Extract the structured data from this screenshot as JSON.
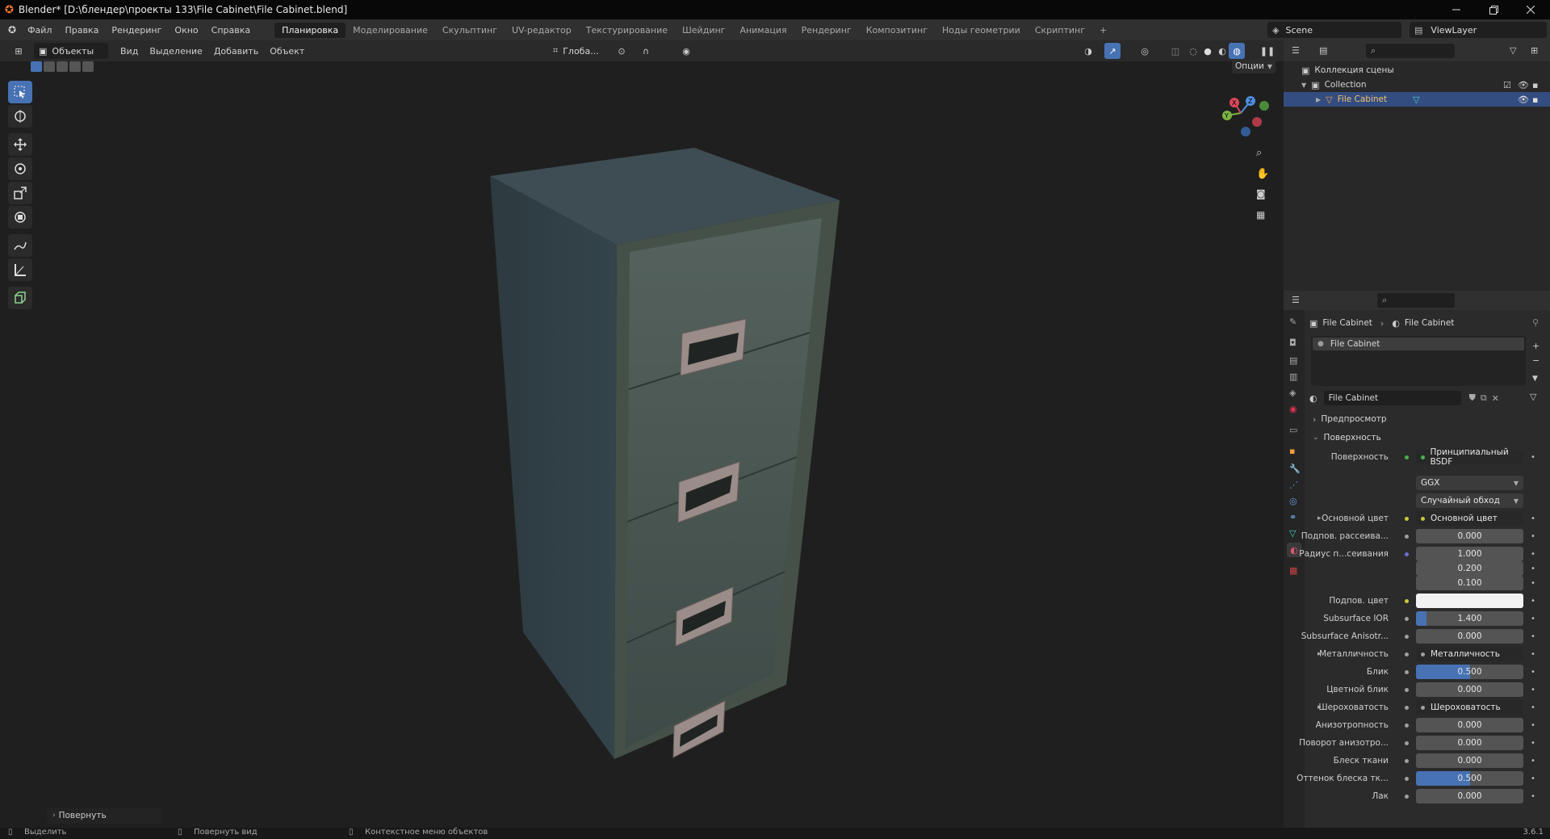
{
  "window": {
    "title": "Blender* [D:\\блендер\\проекты 133\\File Cabinet\\File Cabinet.blend]"
  },
  "menu": {
    "items": [
      "Файл",
      "Правка",
      "Рендеринг",
      "Окно",
      "Справка"
    ]
  },
  "workspaces": [
    "Планировка",
    "Моделирование",
    "Скульптинг",
    "UV-редактор",
    "Текстурирование",
    "Шейдинг",
    "Анимация",
    "Рендеринг",
    "Композитинг",
    "Ноды геометрии",
    "Скриптинг"
  ],
  "workspace_add": "+",
  "scene": {
    "name": "Scene",
    "view_layer": "ViewLayer"
  },
  "viewport_header": {
    "mode": "Объекты",
    "menus": [
      "Вид",
      "Выделение",
      "Добавить",
      "Объект"
    ],
    "orientation": "Глоба...",
    "options": "Опции"
  },
  "last_operator": "Повернуть",
  "outliner": {
    "root": "Коллекция сцены",
    "collection": "Collection",
    "object": "File Cabinet"
  },
  "properties": {
    "breadcrumb": [
      "File Cabinet",
      "File Cabinet"
    ],
    "slot": "File Cabinet",
    "material_name": "File Cabinet",
    "panels": {
      "preview": "Предпросмотр",
      "surface": "Поверхность"
    },
    "rows": [
      {
        "label": "Поверхность",
        "value": "Принципиальный BSDF",
        "kind": "link",
        "dot": "#4caf50"
      },
      {
        "label": "",
        "value": "GGX",
        "kind": "select"
      },
      {
        "label": "",
        "value": "Случайный обход",
        "kind": "select"
      },
      {
        "label": "Основной цвет",
        "value": "Основной цвет",
        "kind": "link",
        "dot": "#c8c83c",
        "expander": "▸"
      },
      {
        "label": "Подпов. рассеива...",
        "value": "0.000",
        "kind": "num",
        "dot": "#a0a0a0"
      },
      {
        "label": "Радиус п...сеивания",
        "value": "1.000",
        "kind": "num",
        "dot": "#6d6dd6"
      },
      {
        "label": "",
        "value": "0.200",
        "kind": "num"
      },
      {
        "label": "",
        "value": "0.100",
        "kind": "num"
      },
      {
        "label": "Подпов. цвет",
        "value": "",
        "kind": "color",
        "dot": "#c8c83c",
        "color": "#f2f2f2"
      },
      {
        "label": "Subsurface IOR",
        "value": "1.400",
        "kind": "num",
        "dot": "#a0a0a0",
        "fill": 0.1
      },
      {
        "label": "Subsurface Anisotr...",
        "value": "0.000",
        "kind": "num",
        "dot": "#a0a0a0"
      },
      {
        "label": "Металличность",
        "value": "Металличность",
        "kind": "link",
        "dot": "#a0a0a0",
        "expander": "▸"
      },
      {
        "label": "Блик",
        "value": "0.500",
        "kind": "num",
        "dot": "#a0a0a0",
        "fill": 0.5
      },
      {
        "label": "Цветной блик",
        "value": "0.000",
        "kind": "num",
        "dot": "#a0a0a0"
      },
      {
        "label": "Шероховатость",
        "value": "Шероховатость",
        "kind": "link",
        "dot": "#a0a0a0",
        "expander": "▸"
      },
      {
        "label": "Анизотропность",
        "value": "0.000",
        "kind": "num",
        "dot": "#a0a0a0"
      },
      {
        "label": "Поворот анизотро...",
        "value": "0.000",
        "kind": "num",
        "dot": "#a0a0a0"
      },
      {
        "label": "Блеск ткани",
        "value": "0.000",
        "kind": "num",
        "dot": "#a0a0a0"
      },
      {
        "label": "Оттенок блеска тк...",
        "value": "0.500",
        "kind": "num",
        "dot": "#a0a0a0",
        "fill": 0.5
      },
      {
        "label": "Лак",
        "value": "0.000",
        "kind": "num",
        "dot": "#a0a0a0"
      }
    ]
  },
  "status": {
    "select": "Выделить",
    "rotate_view": "Повернуть вид",
    "context_menu": "Контекстное меню объектов",
    "version": "3.6.1"
  },
  "colors": {
    "accent": "#4772b3",
    "selected_row": "#334d80",
    "object_label": "#f4c06d"
  }
}
